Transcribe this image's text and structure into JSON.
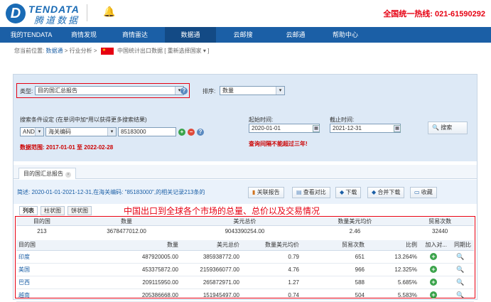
{
  "header": {
    "logo_en": "TENDATA",
    "logo_cn": "腾道数据",
    "hotline": "全国统一热线: 021-61590292"
  },
  "nav": {
    "items": [
      "我的TENDATA",
      "商情发现",
      "商情雷达",
      "数据通",
      "云邮搜",
      "云邮通",
      "帮助中心"
    ]
  },
  "breadcrumb": {
    "prefix": "您当前位置:",
    "home": "数据通",
    "sep1": ">",
    "category": "行业分析",
    "sep2": ">",
    "page": "中国统计出口数据",
    "reselect": "[ 重新选择国家 ▾ ]"
  },
  "search": {
    "type_label": "类型:",
    "type_value": "目的国汇总报告",
    "sort_label": "排序:",
    "sort_value": "数量",
    "cond_label": "搜索条件设定 (在单词中加*用以获得更多搜索结果)",
    "logic_value": "AND",
    "field_value": "海关编码",
    "code_value": "85183000",
    "range_label": "数据范围: 2017-01-01 至 2022-02-28",
    "start_label": "起始时间:",
    "start_value": "2020-01-01",
    "end_label": "截止时间:",
    "end_value": "2021-12-31",
    "limit_note": "查询间隔不能超过三年!",
    "search_button": "搜索"
  },
  "report_tab": {
    "label": "目的国汇总报告",
    "close": "×"
  },
  "summary": {
    "desc": "简述: 2020-01-01-2021-12-31,在海关编码: \"85183000\",的相关记录213条的",
    "actions": [
      "关联报告",
      "查看对比",
      "下载",
      "合并下载",
      "收藏"
    ]
  },
  "subtabs": [
    "列表",
    "柱状图",
    "饼状图"
  ],
  "annotation": "中国出口到全球各个市场的总量、总价以及交易情况",
  "totals": {
    "headers": [
      "目的国",
      "数量",
      "美元总价",
      "数量美元均价",
      "贸易次数"
    ],
    "values": [
      "213",
      "3678477012.00",
      "9043390254.00",
      "2.46",
      "32440"
    ]
  },
  "detail": {
    "headers": [
      "目的国",
      "数量",
      "美元总价",
      "数量美元均价",
      "贸易次数",
      "比例",
      "加入对...",
      "同期比"
    ],
    "rows": [
      {
        "country": "印度",
        "qty": "487920005.00",
        "usd": "385938772.00",
        "avg": "0.79",
        "trades": "651",
        "ratio": "13.264%"
      },
      {
        "country": "美国",
        "qty": "453375872.00",
        "usd": "2159366077.00",
        "avg": "4.76",
        "trades": "966",
        "ratio": "12.325%"
      },
      {
        "country": "巴西",
        "qty": "209115950.00",
        "usd": "265872971.00",
        "avg": "1.27",
        "trades": "588",
        "ratio": "5.685%"
      },
      {
        "country": "越南",
        "qty": "205386668.00",
        "usd": "151945497.00",
        "avg": "0.74",
        "trades": "504",
        "ratio": "5.583%"
      }
    ]
  },
  "colors": {
    "nav_bg": "#1b5fa6",
    "accent_red": "#e60012",
    "panel_bg": "#dde9f6"
  }
}
